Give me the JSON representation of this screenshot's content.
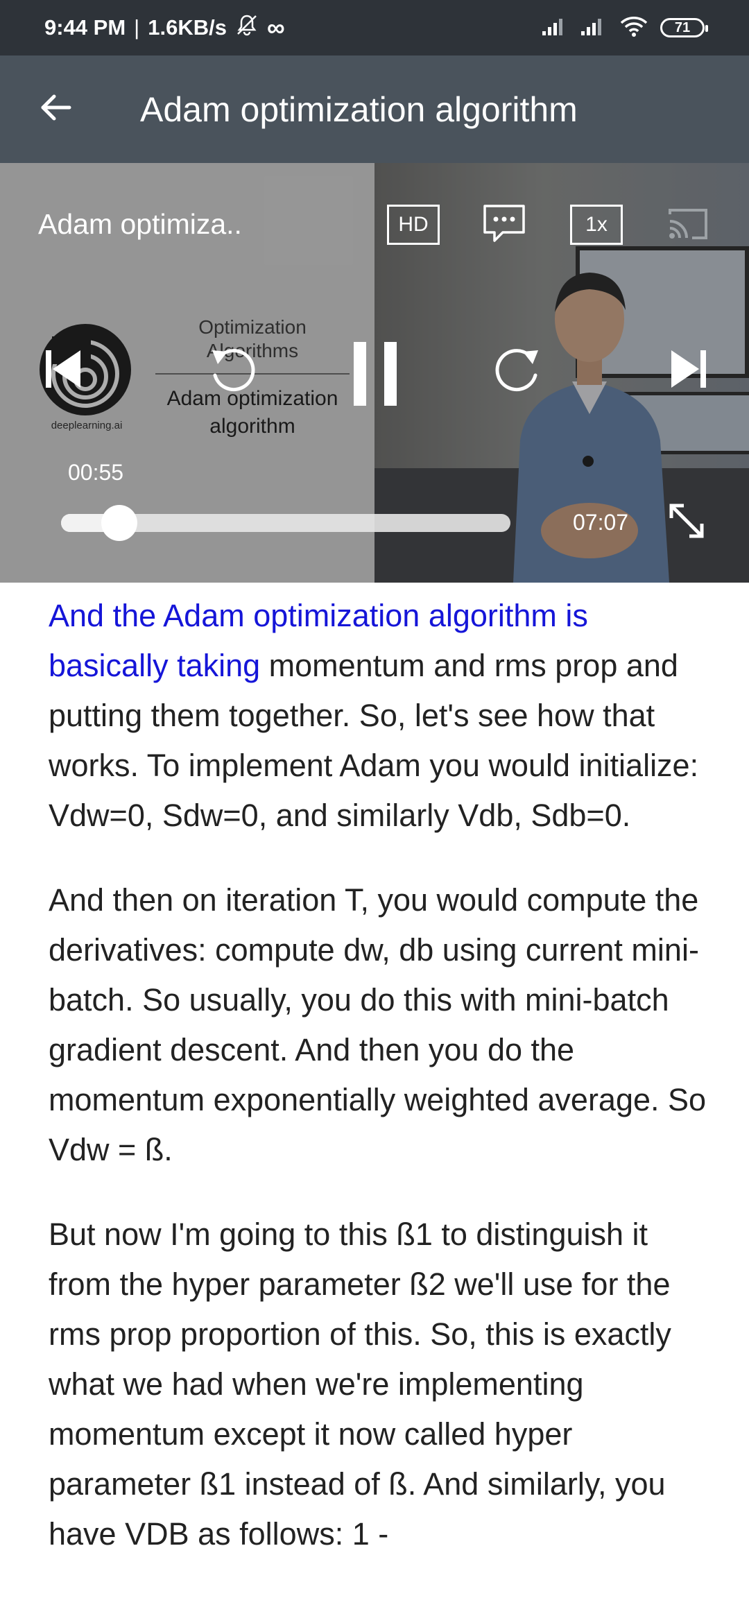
{
  "status_bar": {
    "time": "9:44 PM",
    "separator": "|",
    "speed": "1.6KB/s",
    "infinity": "∞",
    "battery": "71"
  },
  "app_bar": {
    "title": "Adam optimization algorithm"
  },
  "player": {
    "title": "Adam optimiza..",
    "quality": "HD",
    "speed": "1x",
    "current_time": "00:55",
    "duration": "07:07",
    "progress_fraction": 0.129,
    "slide": {
      "brand": "deeplearning.ai",
      "heading": "Optimization Algorithms",
      "main": "Adam optimization algorithm"
    }
  },
  "transcript": {
    "p1_highlight": "And the Adam optimization algorithm is basically taking",
    "p1_rest": " momentum and rms prop and putting them together. So, let's see how that works. To implement Adam you would initialize: Vdw=0, Sdw=0, and similarly Vdb, Sdb=0.",
    "p2": "And then on iteration T, you would compute the derivatives: compute dw, db using current mini-batch. So usually, you do this with mini-batch gradient descent. And then you do the momentum exponentially weighted average.  So Vdw = ß.",
    "p3": "But now I'm going to this ß1 to distinguish it from the hyper parameter ß2 we'll use for the rms prop proportion of this. So, this is exactly what we had when we're implementing momentum except it now called hyper parameter ß1 instead of ß. And similarly, you have VDB as follows: 1 -"
  },
  "icons": {
    "status": [
      "mute-bell-icon",
      "signal-icon",
      "signal-icon",
      "wifi-icon",
      "battery-icon"
    ],
    "app_bar": [
      "back-arrow-icon"
    ],
    "player": [
      "captions-icon",
      "cast-icon",
      "skip-previous-icon",
      "rewind-icon",
      "pause-icon",
      "forward-icon",
      "skip-next-icon",
      "fullscreen-icon"
    ]
  },
  "colors": {
    "status_bar": "#2e3339",
    "app_bar": "#4a535c",
    "highlight": "#1515d8"
  }
}
